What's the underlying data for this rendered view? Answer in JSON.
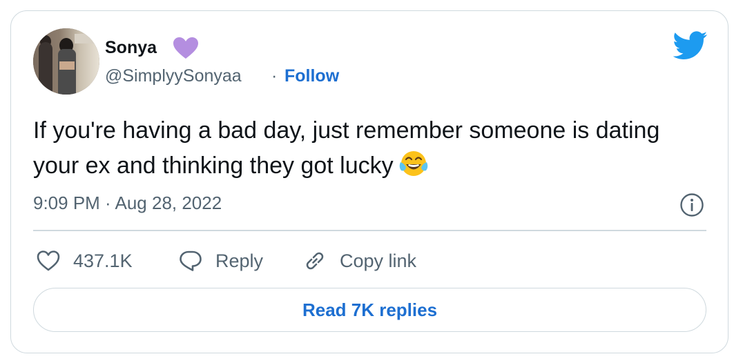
{
  "author": {
    "name": "Sonya",
    "handle": "@SimplyySonyaa",
    "separator": "·",
    "follow_label": "Follow",
    "verified_icon": "purple-heart-icon",
    "badge_color": "#b48ee0"
  },
  "tweet": {
    "text": "If you're having a bad day, just remember someone is dating your ex and thinking they got lucky",
    "emoji": "face-with-tears-of-joy",
    "timestamp": "9:09 PM · Aug 28, 2022"
  },
  "actions": {
    "like_count": "437.1K",
    "reply_label": "Reply",
    "copy_label": "Copy link"
  },
  "footer": {
    "read_replies_label": "Read 7K replies"
  },
  "colors": {
    "accent": "#1d6fd1",
    "twitter_blue": "#1d9bf0",
    "muted": "#536471",
    "border": "#cfd9de"
  }
}
